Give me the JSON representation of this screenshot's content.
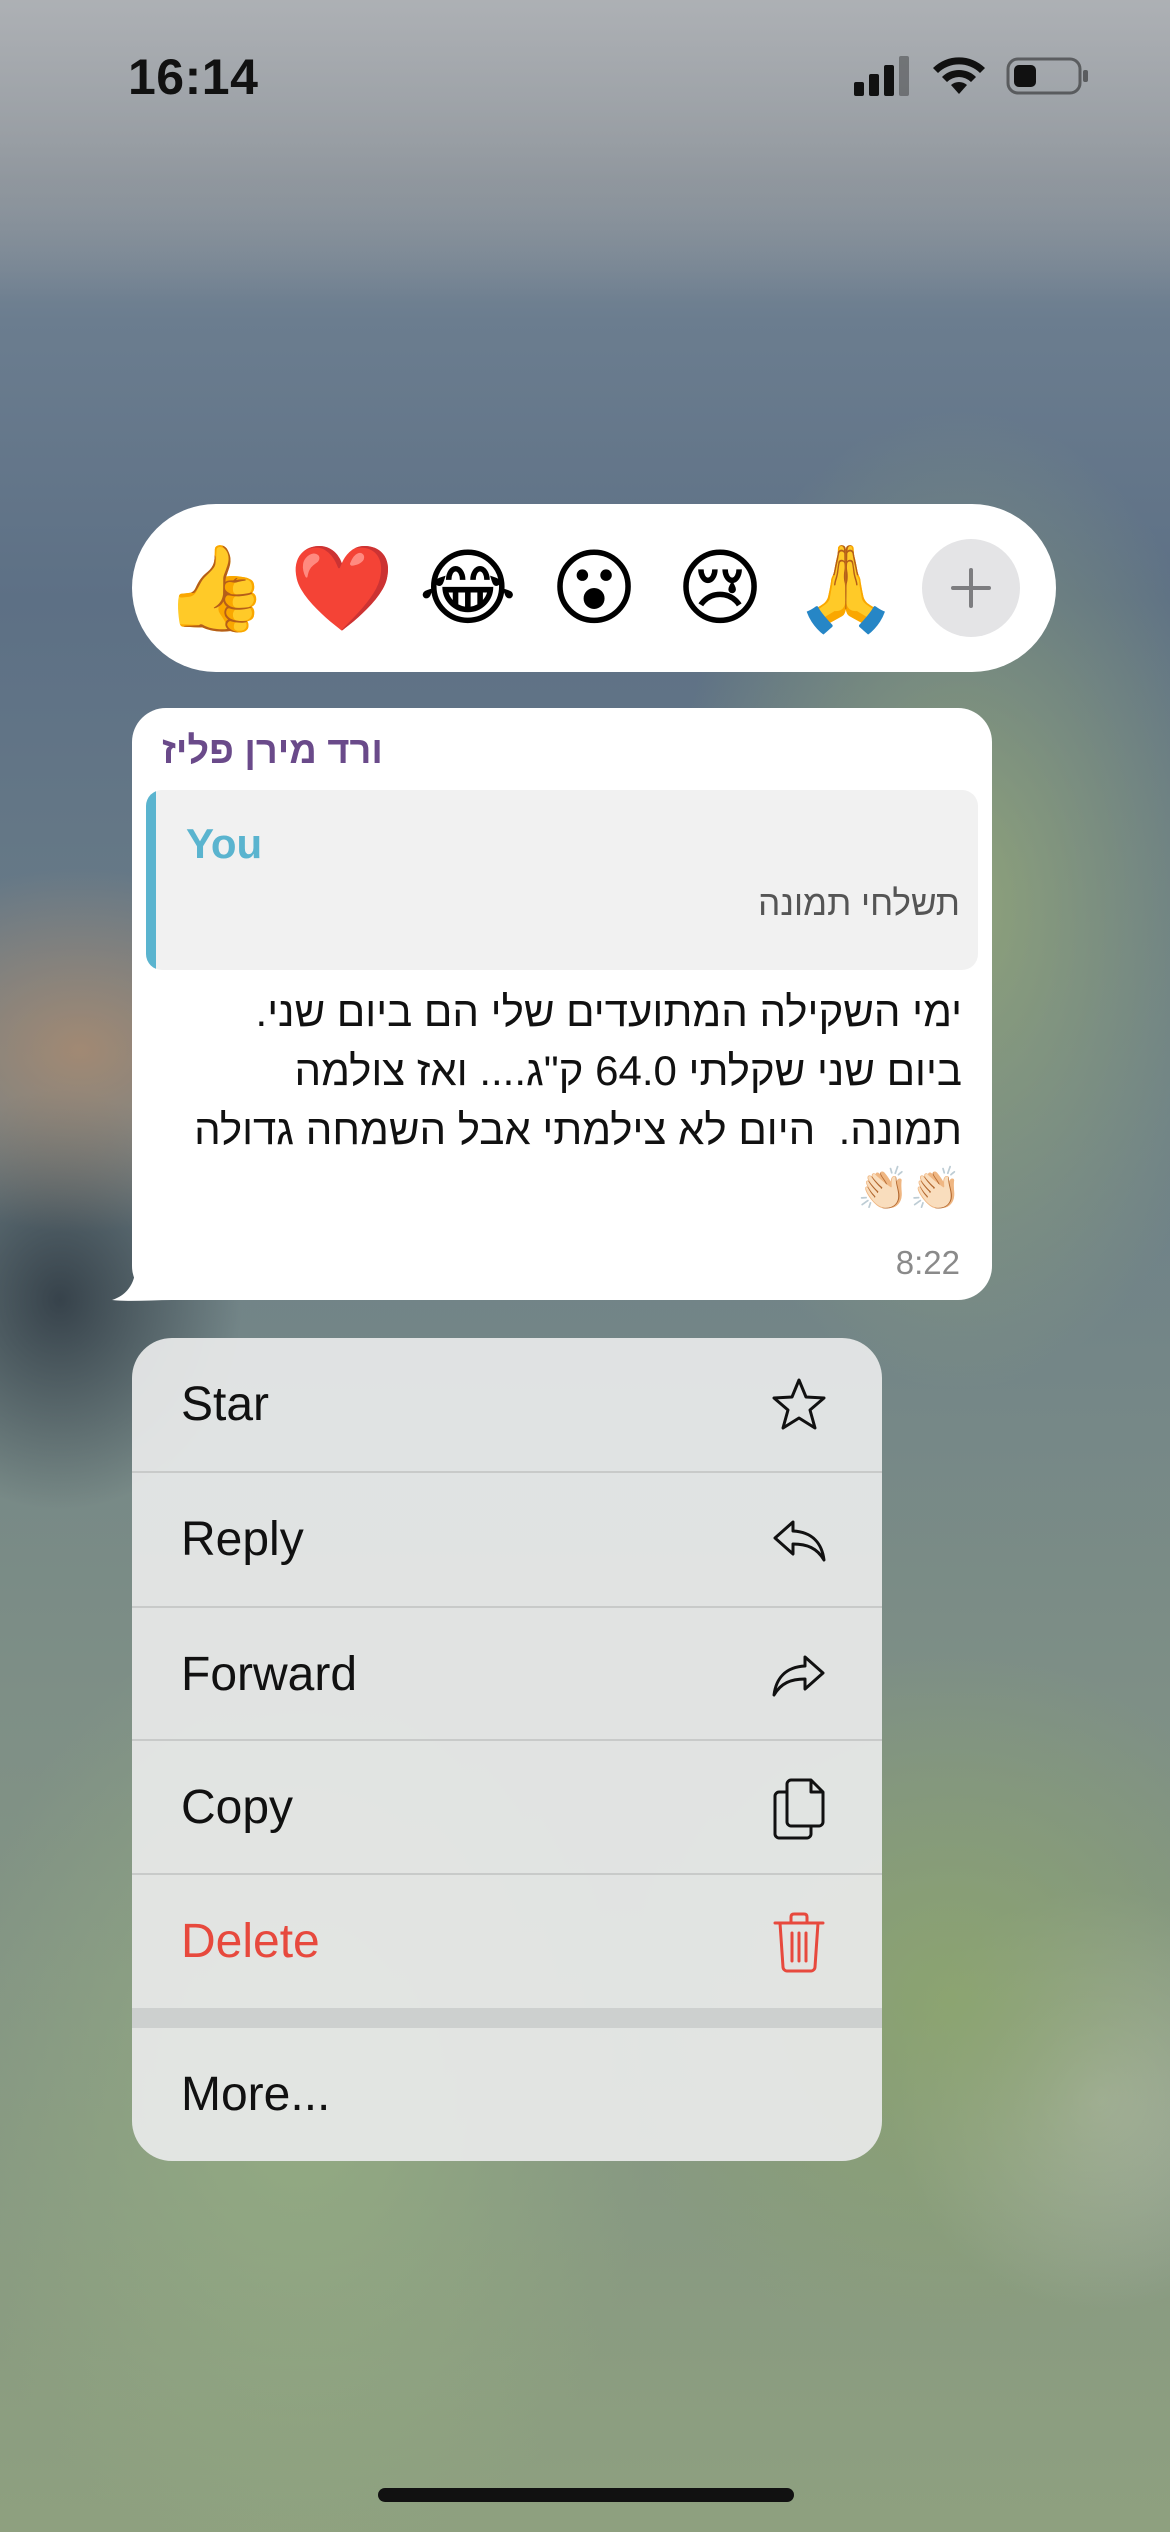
{
  "status_bar": {
    "time": "16:14",
    "icons": [
      "cellular-signal-icon",
      "wifi-icon",
      "battery-icon"
    ]
  },
  "reactions": {
    "items": [
      {
        "emoji": "👍",
        "name": "thumbs-up"
      },
      {
        "emoji": "❤️",
        "name": "red-heart"
      },
      {
        "emoji": "😂",
        "name": "tears-of-joy"
      },
      {
        "emoji": "😮",
        "name": "surprised-face"
      },
      {
        "emoji": "😢",
        "name": "crying-face"
      },
      {
        "emoji": "🙏",
        "name": "folded-hands"
      }
    ],
    "more_icon": "plus-icon"
  },
  "message": {
    "sender": "ורד מירן פליז",
    "quote": {
      "author": "You",
      "text": "תשלחי תמונה"
    },
    "body": "ימי השקילה המתועדים שלי הם ביום שני.\nביום שני שקלתי 64.0 ק\"ג.... ואז צולמה תמונה.  היום לא צילמתי אבל השמחה גדולה👏🏻👏🏻",
    "time": "8:22"
  },
  "menu": {
    "star": "Star",
    "reply": "Reply",
    "forward": "Forward",
    "copy": "Copy",
    "delete": "Delete",
    "more": "More..."
  },
  "colors": {
    "sender_name": "#6a4a8a",
    "quote_accent": "#5ab4cf",
    "delete_red": "#e7493d"
  }
}
